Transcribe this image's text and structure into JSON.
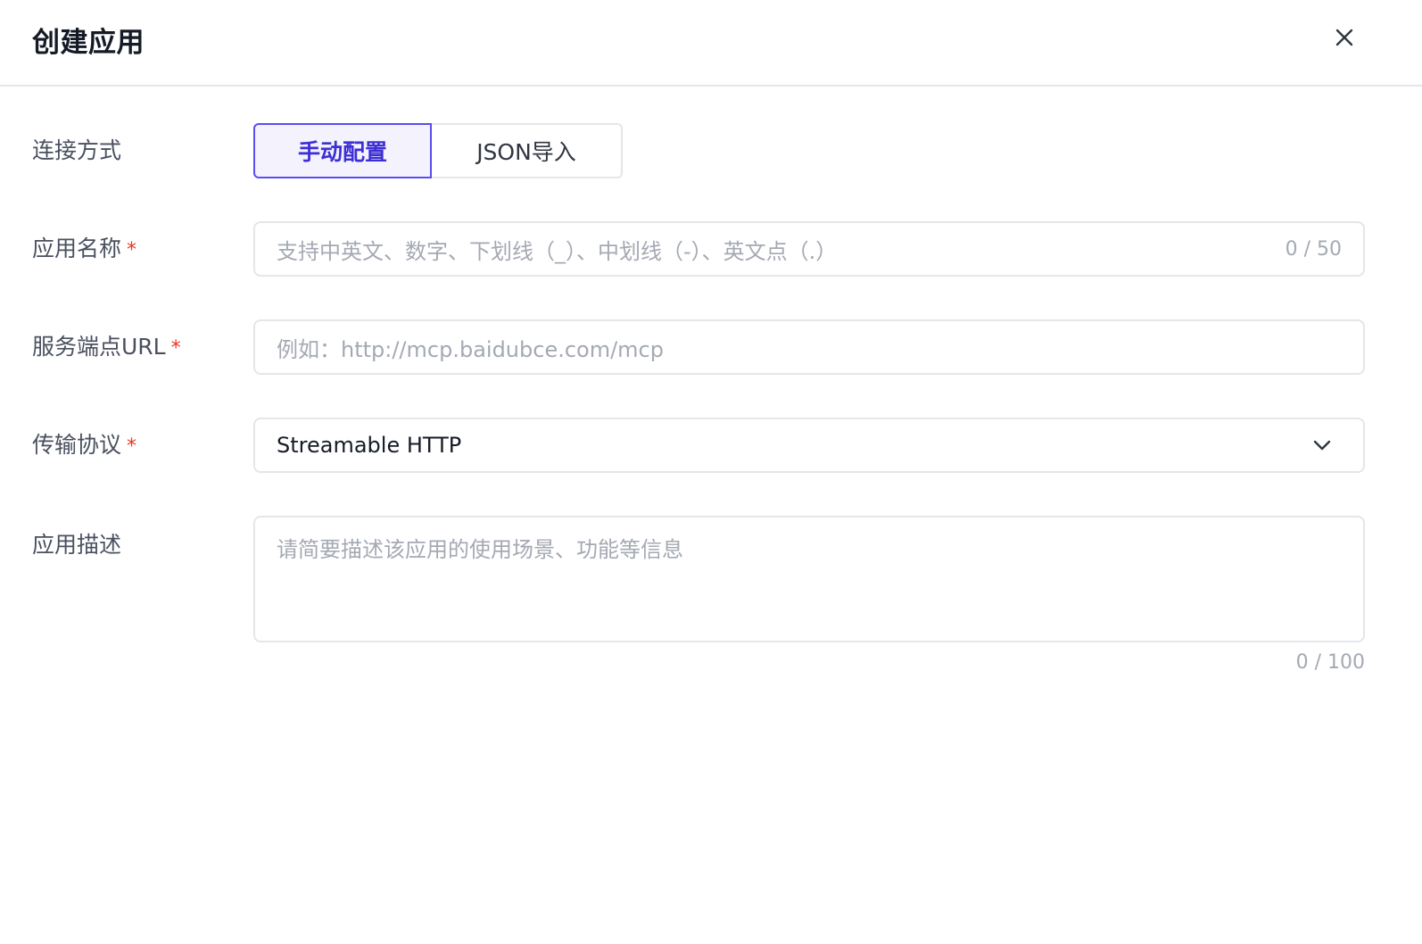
{
  "dialog": {
    "title": "创建应用",
    "close_icon": "close-icon"
  },
  "form": {
    "connection": {
      "label": "连接方式",
      "options": [
        {
          "label": "手动配置",
          "selected": true
        },
        {
          "label": "JSON导入",
          "selected": false
        }
      ]
    },
    "app_name": {
      "label": "应用名称",
      "required_mark": "*",
      "placeholder": "支持中英文、数字、下划线（_）、中划线（-）、英文点（.）",
      "value": "",
      "counter": "0 / 50"
    },
    "endpoint_url": {
      "label": "服务端点URL",
      "required_mark": "*",
      "placeholder": "例如：http://mcp.baidubce.com/mcp",
      "value": ""
    },
    "protocol": {
      "label": "传输协议",
      "required_mark": "*",
      "value": "Streamable HTTP",
      "icon": "chevron-down-icon"
    },
    "description": {
      "label": "应用描述",
      "placeholder": "请简要描述该应用的使用场景、功能等信息",
      "value": "",
      "counter": "0 / 100"
    }
  },
  "colors": {
    "accent": "#5b4bf0",
    "accent_text": "#3d2fd6",
    "required": "#f0341f",
    "border": "#e4e6ea",
    "placeholder": "#a4a9b3"
  }
}
